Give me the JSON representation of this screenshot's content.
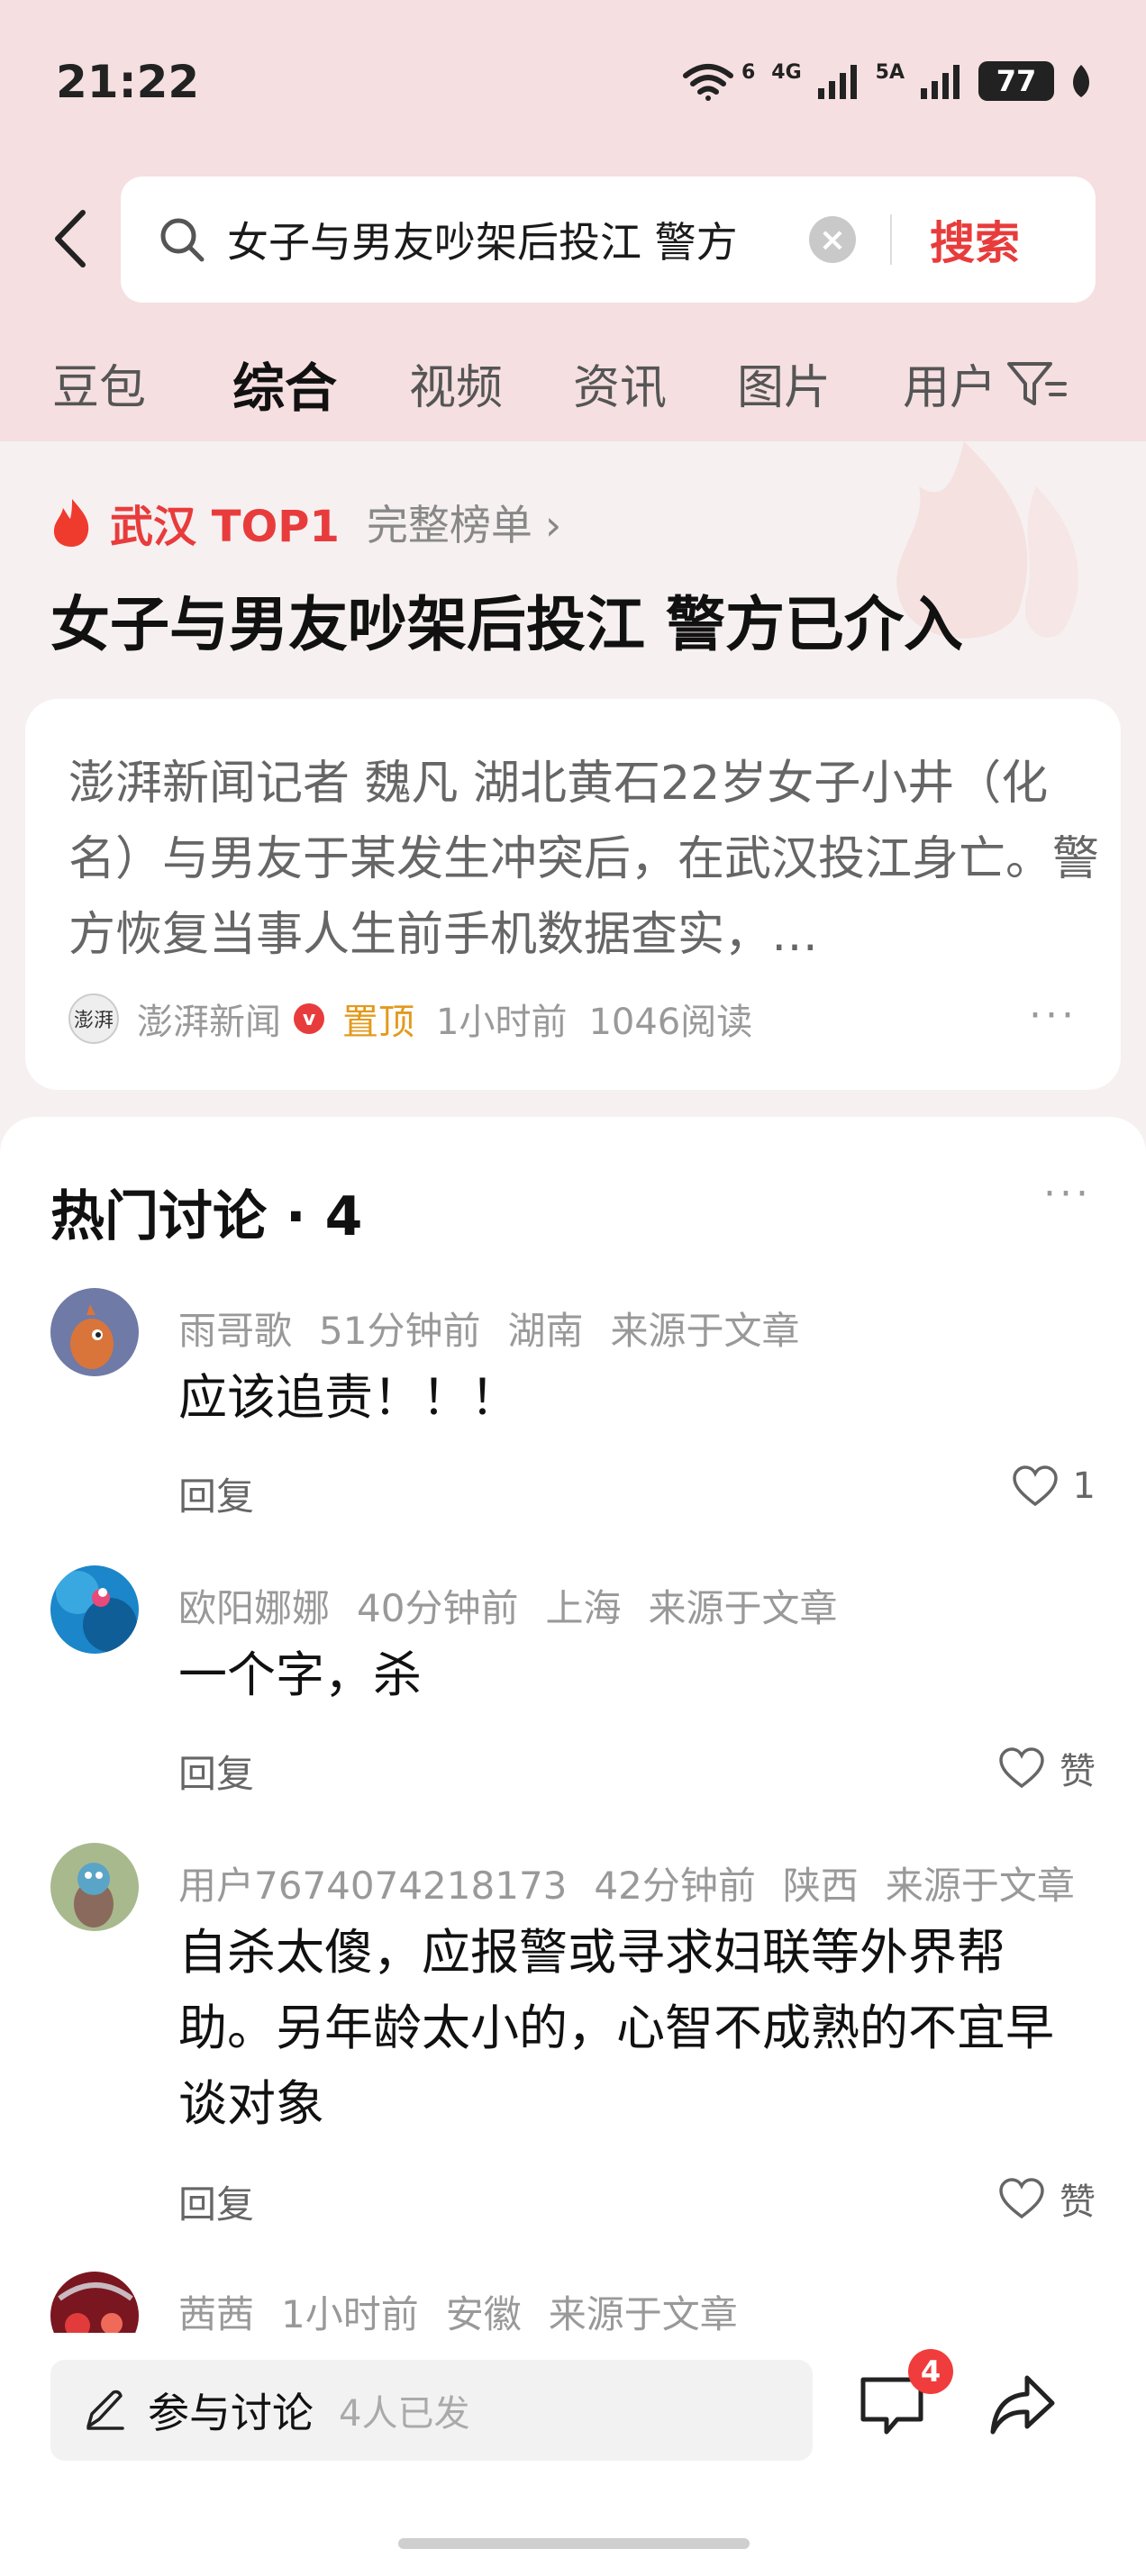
{
  "status_bar": {
    "time": "21:22",
    "wifi": "6",
    "signal1": "4G",
    "signal2": "5A",
    "battery": "77"
  },
  "search": {
    "query": "女子与男友吵架后投江 警方",
    "button": "搜索"
  },
  "tabs": [
    "豆包",
    "综合",
    "视频",
    "资讯",
    "图片",
    "用户"
  ],
  "topic": {
    "tag": "武汉 TOP1",
    "link": "完整榜单",
    "headline": "女子与男友吵架后投江 警方已介入"
  },
  "article": {
    "summary": "澎湃新闻记者 魏凡 湖北黄石22岁女子小井（化名）与男友于某发生冲突后，在武汉投江身亡。警方恢复当事人生前手机数据查实，…",
    "source_avatar_text": "澎湃",
    "source": "澎湃新闻",
    "verified": "v",
    "pinned": "置顶",
    "time": "1小时前",
    "reads": "1046阅读",
    "more": "···"
  },
  "comments": {
    "title": "热门讨论 · 4",
    "more": "···",
    "reply_label": "回复",
    "items": [
      {
        "user": "雨哥歌",
        "time": "51分钟前",
        "location": "湖南",
        "source": "来源于文章",
        "text": "应该追责！！！",
        "likes": "1"
      },
      {
        "user": "欧阳娜娜",
        "time": "40分钟前",
        "location": "上海",
        "source": "来源于文章",
        "text": "一个字，杀",
        "likes": "赞"
      },
      {
        "user": "用户7674074218173",
        "time": "42分钟前",
        "location": "陕西",
        "source": "来源于文章",
        "text": "自杀太傻，应报警或寻求妇联等外界帮助。另年龄太小的，心智不成熟的不宜早谈对象",
        "likes": "赞"
      },
      {
        "user": "茜茜",
        "time": "1小时前",
        "location": "安徽",
        "source": "来源于文章"
      }
    ]
  },
  "bottom": {
    "discuss_label": "参与讨论",
    "discuss_count": "4人已发",
    "comment_badge": "4"
  },
  "colors": {
    "accent": "#e83c3c",
    "header_bg": "#f5dfe1",
    "pinned": "#e39a1d"
  }
}
